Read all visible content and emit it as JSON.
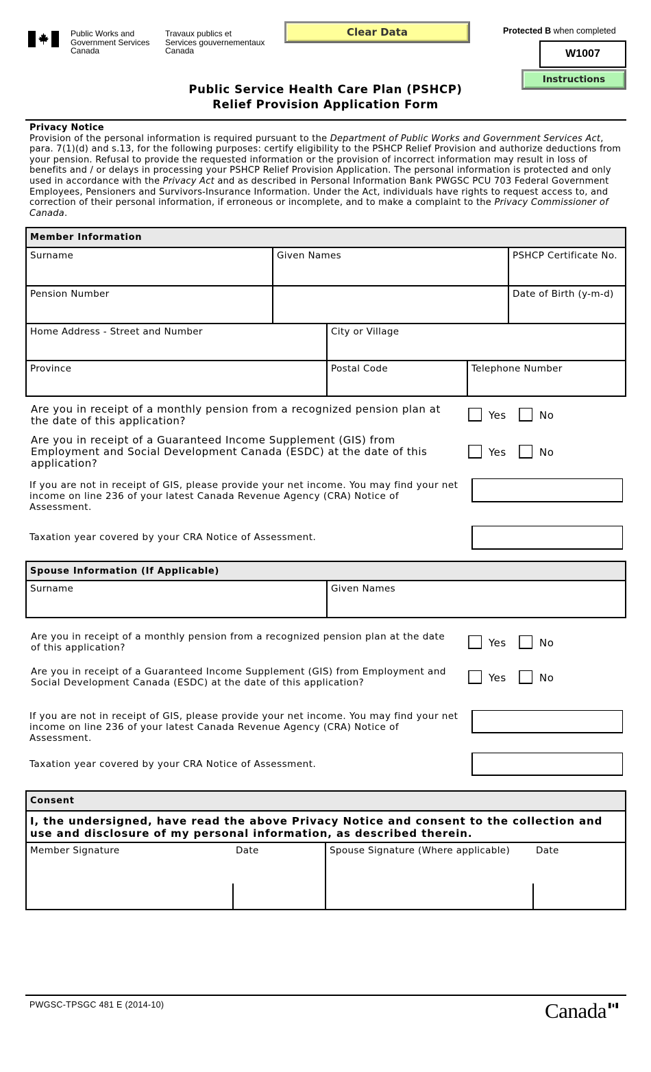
{
  "header": {
    "dept_en": [
      "Public Works and",
      "Government Services",
      "Canada"
    ],
    "dept_fr": [
      "Travaux publics et",
      "Services gouvernementaux",
      "Canada"
    ],
    "clear_button": "Clear Data",
    "protected_label": "Protected B",
    "protected_suffix": " when completed",
    "form_code": "W1007",
    "instructions_button": "Instructions",
    "title_line1": "Public Service Health Care Plan (PSHCP)",
    "title_line2": "Relief Provision Application Form"
  },
  "privacy": {
    "heading": "Privacy Notice",
    "p1": "Provision of the personal information is required pursuant to the ",
    "p1_italic": "Department of Public Works and Government Services Act",
    "p2": ", para. 7(1)(d) and s.13, for the following purposes: certify eligibility to the PSHCP Relief Provision and authorize deductions from your pension. Refusal to provide the requested information or the provision of incorrect information may result in loss of benefits and / or delays in processing your PSHCP Relief Provision Application. The personal information is protected and only used in accordance with the ",
    "p2_italic": "Privacy Act",
    "p3": " and as described in Personal Information Bank PWGSC PCU 703 Federal Government Employees, Pensioners and Survivors-Insurance Information. Under the Act, individuals have rights to request access to, and correction of their personal information, if erroneous or incomplete, and to make a complaint to the ",
    "p3_italic": "Privacy Commissioner of Canada",
    "p4": "."
  },
  "member": {
    "heading": "Member Information",
    "fields": {
      "surname": "Surname",
      "given_names": "Given Names",
      "certificate": "PSHCP Certificate No.",
      "pension_number": "Pension Number",
      "dob": "Date of Birth (y-m-d)",
      "address": "Home Address - Street and Number",
      "city": "City or Village",
      "province": "Province",
      "postal": "Postal Code",
      "telephone": "Telephone Number"
    },
    "q_pension": "Are you in receipt of a monthly pension from a recognized pension plan at the date of this application?",
    "q_gis": "Are you in receipt of a Guaranteed Income Supplement (GIS) from Employment and Social Development Canada (ESDC) at the date of this application?",
    "net_income": "If you are not in receipt of GIS, please provide your net income. You may find your net income on line 236 of your latest Canada Revenue Agency (CRA) Notice of Assessment.",
    "tax_year": "Taxation year covered by your CRA Notice of Assessment."
  },
  "spouse": {
    "heading": "Spouse Information (If Applicable)",
    "fields": {
      "surname": "Surname",
      "given_names": "Given Names"
    },
    "q_pension": "Are you in receipt of a monthly pension from a recognized pension plan at the date of this application?",
    "q_gis": "Are you in receipt of a Guaranteed Income Supplement (GIS) from Employment and Social Development Canada (ESDC) at the date of this application?",
    "net_income": "If you are not in receipt of GIS, please provide your net income. You may find your net income on line 236 of your latest Canada Revenue Agency (CRA) Notice of Assessment.",
    "tax_year": "Taxation year covered by your CRA Notice of Assessment."
  },
  "options": {
    "yes": "Yes",
    "no": "No"
  },
  "consent": {
    "heading": "Consent",
    "statement": "I, the undersigned, have read the above Privacy Notice and consent to the collection and use and disclosure of my personal information, as described therein.",
    "member_signature": "Member Signature",
    "date": "Date",
    "spouse_signature": "Spouse Signature (Where applicable)"
  },
  "footer": {
    "form_number": "PWGSC-TPSGC 481 E (2014-10)",
    "wordmark": "Canada"
  },
  "colors": {
    "clear_button_bg": "#ffff99",
    "instructions_button_bg": "#b3f5b3",
    "section_header_bg": "#e8e8e8"
  }
}
